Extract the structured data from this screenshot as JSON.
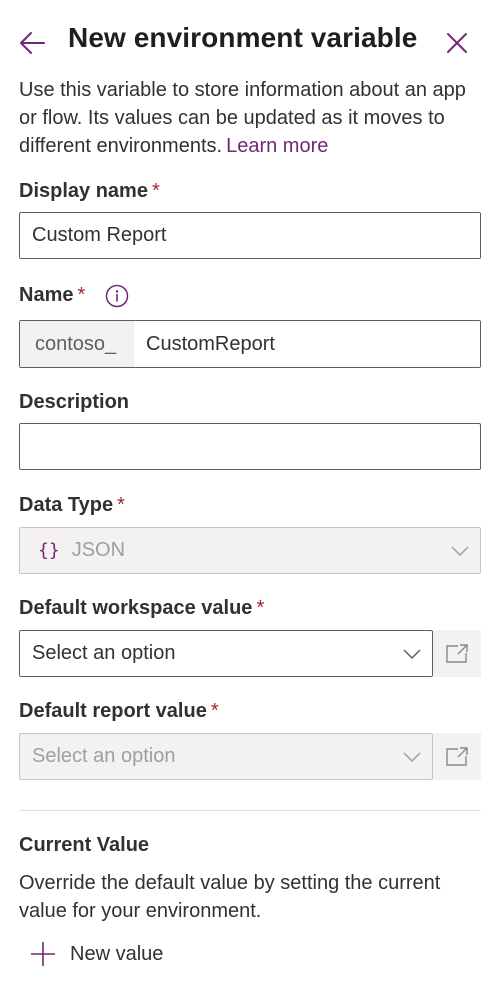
{
  "header": {
    "title": "New environment variable",
    "back_icon": "back-arrow-icon",
    "close_icon": "close-icon"
  },
  "intro": {
    "text": "Use this variable to store information about an app or flow. Its values can be updated as it moves to different environments.",
    "link_text": "Learn more"
  },
  "fields": {
    "display_name": {
      "label": "Display name",
      "required_mark": "*",
      "value": "Custom Report"
    },
    "name": {
      "label": "Name",
      "required_mark": "*",
      "prefix": "contoso_",
      "value": "CustomReport",
      "info_icon": "info-icon"
    },
    "description": {
      "label": "Description",
      "value": ""
    },
    "data_type": {
      "label": "Data Type",
      "required_mark": "*",
      "icon_glyph": "{}",
      "value": "JSON"
    },
    "default_workspace": {
      "label": "Default workspace value",
      "required_mark": "*",
      "placeholder": "Select an option"
    },
    "default_report": {
      "label": "Default report value",
      "required_mark": "*",
      "placeholder": "Select an option"
    }
  },
  "current_value": {
    "title": "Current Value",
    "description": "Override the default value by setting the current value for your environment.",
    "new_value_label": "New value"
  },
  "colors": {
    "accent": "#742774",
    "required": "#a4262c",
    "text": "#323130",
    "border": "#605e5c",
    "disabled_bg": "#f3f2f1"
  }
}
